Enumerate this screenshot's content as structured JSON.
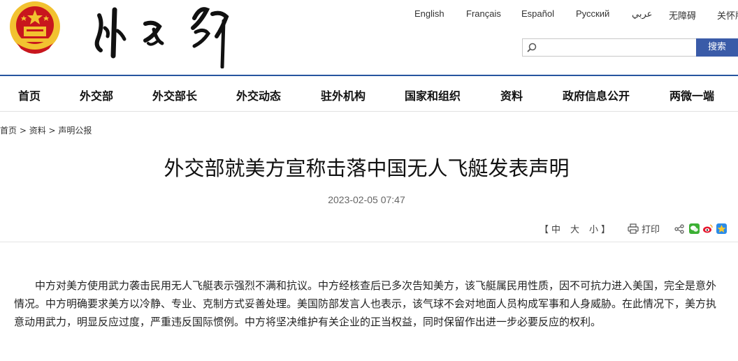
{
  "header": {
    "languages": [
      "English",
      "Français",
      "Español",
      "Русский",
      "عربي",
      "无障碍",
      "关怀版"
    ],
    "search_placeholder": "",
    "search_button": "搜索"
  },
  "nav": {
    "items": [
      "首页",
      "外交部",
      "外交部长",
      "外交动态",
      "驻外机构",
      "国家和组织",
      "资料",
      "政府信息公开",
      "两微一端"
    ]
  },
  "breadcrumb": {
    "items": [
      "首页",
      "资料",
      "声明公报"
    ],
    "separator": " > "
  },
  "article": {
    "title": "外交部就美方宣称击落中国无人飞艇发表声明",
    "date": "2023-02-05 07:47",
    "font_open": "【",
    "font_sizes": [
      "中",
      "大",
      "小"
    ],
    "font_close": "】",
    "print_label": "打印",
    "paragraph": "中方对美方使用武力袭击民用无人飞艇表示强烈不满和抗议。中方经核查后已多次告知美方，该飞艇属民用性质，因不可抗力进入美国，完全是意外情况。中方明确要求美方以冷静、专业、克制方式妥善处理。美国防部发言人也表示，该气球不会对地面人员构成军事和人身威胁。在此情况下，美方执意动用武力，明显反应过度，严重违反国际惯例。中方将坚决维护有关企业的正当权益，同时保留作出进一步必要反应的权利。"
  },
  "share_icons": [
    "share-icon",
    "wechat-icon",
    "weibo-icon",
    "qzone-icon"
  ],
  "colors": {
    "brand_blue": "#26549f",
    "button_blue": "#3a5ba8",
    "emblem_red": "#c8161d",
    "emblem_gold": "#f2c230"
  }
}
